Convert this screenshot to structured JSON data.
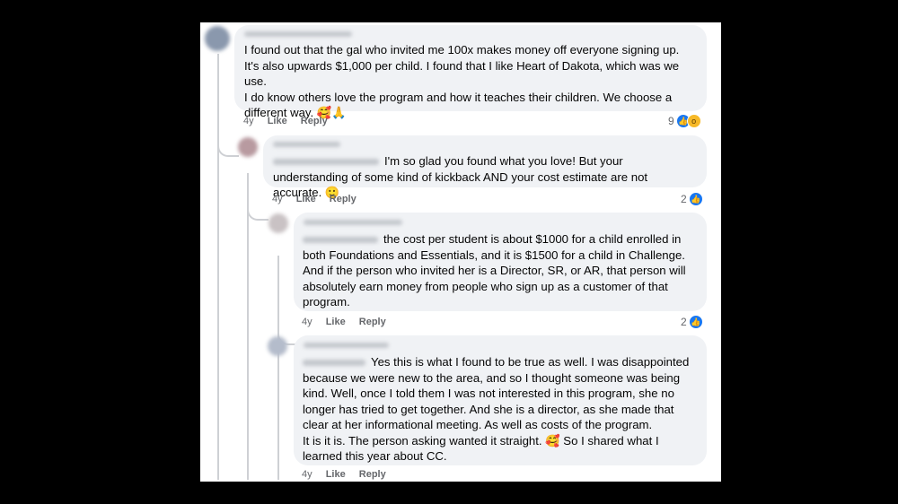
{
  "comments": [
    {
      "text": "I found out that the gal who invited me 100x makes money off everyone signing up. It's also upwards $1,000 per child. I found that I like Heart of Dakota, which was we use.\nI do know others love the program and how it teaches their children. We choose a different way. 🥰🙏",
      "time": "4y",
      "like": "Like",
      "reply": "Reply",
      "reaction_count": "9",
      "reactions": [
        "like-icon",
        "wow-icon"
      ]
    },
    {
      "text": "I'm so glad you found what you love! But your understanding of some kind of kickback AND your cost estimate are not accurate. 🙂",
      "time": "4y",
      "like": "Like",
      "reply": "Reply",
      "reaction_count": "2",
      "reactions": [
        "like-icon"
      ]
    },
    {
      "text": "the cost per student is about $1000 for a child enrolled in both Foundations and Essentials, and it is $1500 for a child in Challenge. And if the person who invited her is a Director, SR, or AR, that person will absolutely earn money from people who sign up as a customer of that program.",
      "time": "4y",
      "like": "Like",
      "reply": "Reply",
      "reaction_count": "2",
      "reactions": [
        "like-icon"
      ]
    },
    {
      "text": "Yes this is what I found to be true as well. I was disappointed because we were new to the area, and so I thought someone was being kind. Well, once I told them I was not interested in this program, she no longer has tried to get together. And she is a director, as she made that clear at her informational meeting. As well as costs of the program.\nIt is it is. The person asking wanted it straight. 🥰 So I shared what I learned this year about CC.",
      "time": "4y",
      "like": "Like",
      "reply": "Reply"
    }
  ],
  "colors": {
    "bubble": "#f0f2f5",
    "like_blue": "#1877f2",
    "wow_yellow": "#f7b928",
    "meta_gray": "#65676b"
  }
}
